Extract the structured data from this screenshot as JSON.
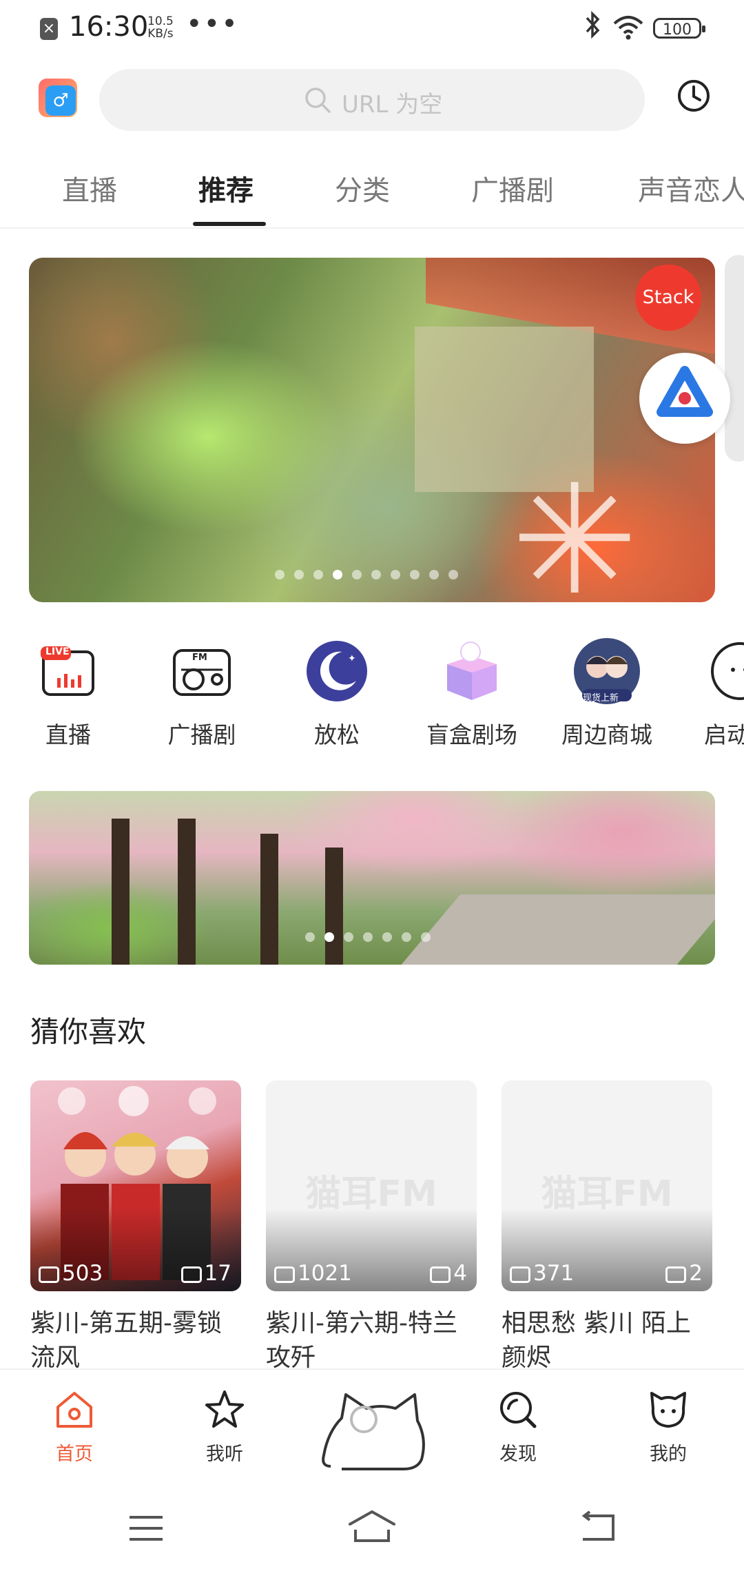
{
  "status_bar": {
    "time": "16:30",
    "speed_value": "10.5",
    "speed_unit": "KB/s",
    "more": "•••",
    "battery": "100"
  },
  "header": {
    "search_placeholder": "URL 为空"
  },
  "tabs": [
    {
      "label": "直播"
    },
    {
      "label": "推荐"
    },
    {
      "label": "分类"
    },
    {
      "label": "广播剧"
    },
    {
      "label": "声音恋人"
    }
  ],
  "active_tab": "推荐",
  "banner": {
    "badge": "Stack",
    "page_count": 10,
    "active_index": 3
  },
  "quick_entries": [
    {
      "label": "直播",
      "icon": "live-icon",
      "badge": "LIVE"
    },
    {
      "label": "广播剧",
      "icon": "radio-icon",
      "badge": "FM"
    },
    {
      "label": "放松",
      "icon": "moon-icon"
    },
    {
      "label": "盲盒剧场",
      "icon": "blind-box-icon"
    },
    {
      "label": "周边商城",
      "icon": "shop-avatar-icon",
      "badge": "现货上新"
    },
    {
      "label": "启动",
      "icon": "start-icon"
    }
  ],
  "banner2": {
    "page_count": 7,
    "active_index": 1
  },
  "section": {
    "title": "猜你喜欢"
  },
  "cards": [
    {
      "plays": "503",
      "episodes": "17",
      "title": "紫川-第五期-雾锁流风",
      "watermark": ""
    },
    {
      "plays": "1021",
      "episodes": "4",
      "title": "紫川-第六期-特兰攻歼",
      "watermark": "猫耳FM"
    },
    {
      "plays": "371",
      "episodes": "2",
      "title": "相思愁 紫川 陌上颜烬",
      "watermark": "猫耳FM"
    }
  ],
  "bottom_nav": [
    {
      "label": "首页",
      "icon": "home-icon",
      "active": true
    },
    {
      "label": "我听",
      "icon": "star-icon",
      "active": false
    },
    {
      "label": "发现",
      "icon": "discover-icon",
      "active": false
    },
    {
      "label": "我的",
      "icon": "cat-face-icon",
      "active": false
    }
  ],
  "colors": {
    "accent": "#ee5a36",
    "stack_badge": "#ee3a2e"
  }
}
